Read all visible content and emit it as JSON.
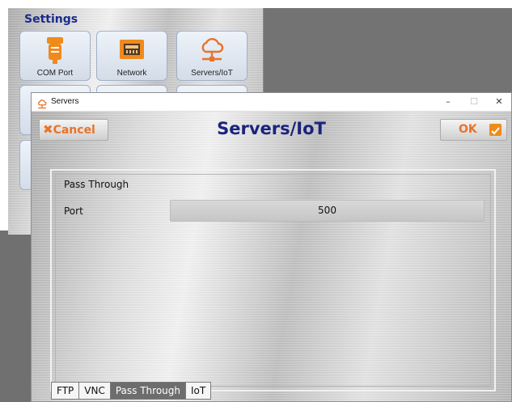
{
  "settings": {
    "title": "Settings",
    "tiles": [
      {
        "label": "COM Port",
        "icon": "serial-port-icon"
      },
      {
        "label": "Network",
        "icon": "ethernet-port-icon"
      },
      {
        "label": "Servers/IoT",
        "icon": "cloud-network-icon"
      }
    ]
  },
  "window": {
    "title": "Servers",
    "icon": "cloud-network-icon",
    "controls": {
      "minimize": "–",
      "maximize": "☐",
      "close": "✕"
    }
  },
  "dialog": {
    "title": "Servers/IoT",
    "cancel_label": "Cancel",
    "ok_label": "OK"
  },
  "pass_through": {
    "group_label": "Pass Through",
    "port_label": "Port",
    "port_value": "500"
  },
  "tabs": [
    {
      "label": "FTP",
      "active": false
    },
    {
      "label": "VNC",
      "active": false
    },
    {
      "label": "Pass Through",
      "active": true
    },
    {
      "label": "IoT",
      "active": false
    }
  ],
  "colors": {
    "accent_orange": "#e8732a",
    "title_navy": "#1a237e",
    "settings_title": "#1a2a8a",
    "active_tab": "#6d6d6d"
  }
}
